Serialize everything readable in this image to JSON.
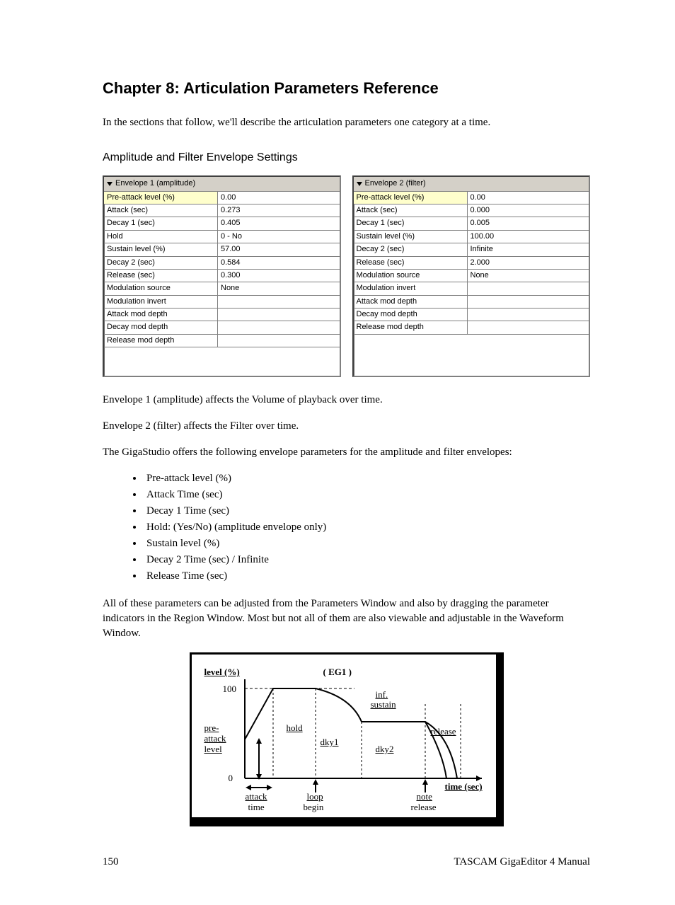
{
  "chapter_title": "Chapter 8: Articulation Parameters Reference",
  "intro": "In the sections that follow, we'll describe the articulation parameters one category at a time.",
  "section_title": "Amplitude and Filter Envelope Settings",
  "panel1": {
    "header": "Envelope 1 (amplitude)",
    "rows": [
      {
        "k": "Pre-attack level (%)",
        "v": "0.00",
        "hl": true
      },
      {
        "k": "Attack (sec)",
        "v": "0.273"
      },
      {
        "k": "Decay 1 (sec)",
        "v": "0.405"
      },
      {
        "k": "Hold",
        "v": "0 - No"
      },
      {
        "k": "Sustain level (%)",
        "v": "57.00"
      },
      {
        "k": "Decay 2 (sec)",
        "v": "0.584"
      },
      {
        "k": "Release (sec)",
        "v": "0.300"
      },
      {
        "k": "Modulation source",
        "v": "None"
      },
      {
        "k": "Modulation invert",
        "v": ""
      },
      {
        "k": "Attack mod depth",
        "v": ""
      },
      {
        "k": "Decay mod depth",
        "v": ""
      },
      {
        "k": "Release mod depth",
        "v": ""
      }
    ]
  },
  "panel2": {
    "header": "Envelope 2 (filter)",
    "rows": [
      {
        "k": "Pre-attack level (%)",
        "v": "0.00",
        "hl": true
      },
      {
        "k": "Attack (sec)",
        "v": "0.000"
      },
      {
        "k": "Decay 1 (sec)",
        "v": "0.005"
      },
      {
        "k": "Sustain level (%)",
        "v": "100.00"
      },
      {
        "k": "Decay 2 (sec)",
        "v": "Infinite"
      },
      {
        "k": "Release (sec)",
        "v": "2.000"
      },
      {
        "k": "Modulation source",
        "v": "None"
      },
      {
        "k": "Modulation invert",
        "v": ""
      },
      {
        "k": "Attack mod depth",
        "v": ""
      },
      {
        "k": "Decay mod depth",
        "v": ""
      },
      {
        "k": "Release mod depth",
        "v": ""
      }
    ]
  },
  "para_env1": "Envelope 1 (amplitude) affects the Volume of playback over time.",
  "para_env2": "Envelope 2 (filter) affects the Filter over time.",
  "para_list_intro": "The GigaStudio offers the following envelope parameters for the amplitude and filter envelopes:",
  "bullets": [
    "Pre-attack level (%)",
    "Attack Time (sec)",
    "Decay 1 Time (sec)",
    "Hold: (Yes/No) (amplitude envelope only)",
    "Sustain level (%)",
    "Decay 2 Time (sec) / Infinite",
    "Release Time (sec)"
  ],
  "para_after": "All of these parameters can be adjusted from the Parameters Window and also by dragging the parameter indicators in the Region Window. Most but not all of them are also viewable and adjustable in the Waveform Window.",
  "diagram": {
    "level_pct": "level (%)",
    "hundred": "100",
    "inf": "inf.",
    "sustain": "sustain",
    "pre": "pre-",
    "attack_lbl": "attack",
    "level_lbl": "level",
    "zero": "0",
    "hold": "hold",
    "dky1": "dky1",
    "dky2": "dky2",
    "release": "release",
    "attack_b": "attack",
    "time_b": "time",
    "loop": "loop",
    "begin": "begin",
    "note": "note",
    "release_b": "release",
    "time_sec": "time (sec)",
    "eg1": "( EG1 )"
  },
  "footer": {
    "page": "150",
    "manual": "TASCAM GigaEditor 4 Manual"
  }
}
